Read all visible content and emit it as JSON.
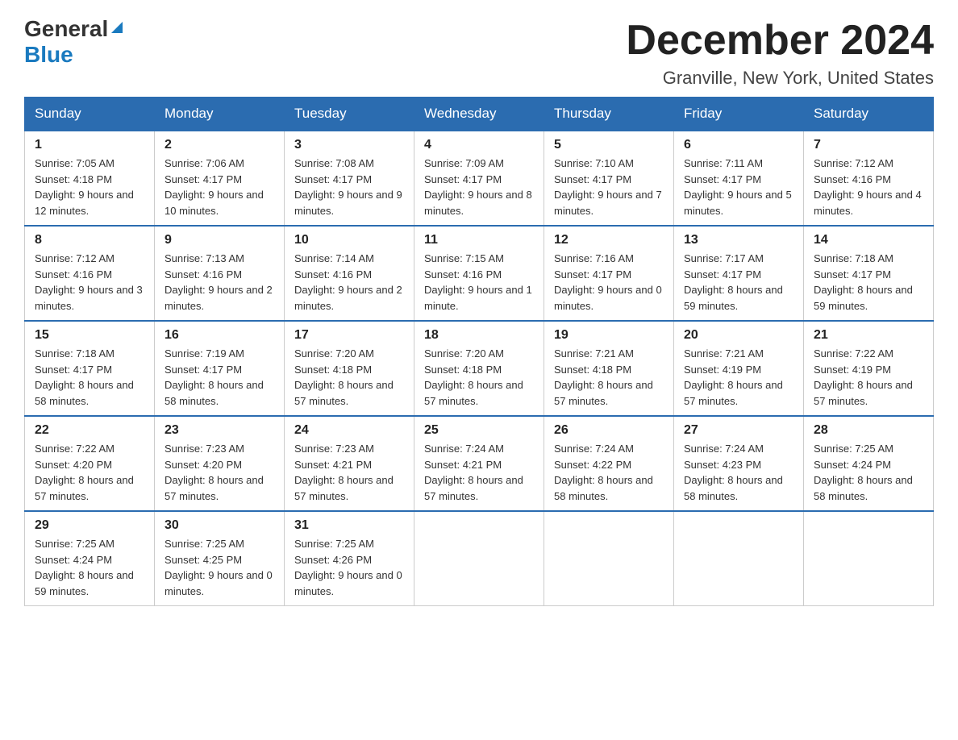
{
  "header": {
    "logo_general": "General",
    "logo_blue": "Blue",
    "month_title": "December 2024",
    "location": "Granville, New York, United States"
  },
  "days_of_week": [
    "Sunday",
    "Monday",
    "Tuesday",
    "Wednesday",
    "Thursday",
    "Friday",
    "Saturday"
  ],
  "weeks": [
    [
      {
        "day": "1",
        "sunrise": "7:05 AM",
        "sunset": "4:18 PM",
        "daylight": "9 hours and 12 minutes."
      },
      {
        "day": "2",
        "sunrise": "7:06 AM",
        "sunset": "4:17 PM",
        "daylight": "9 hours and 10 minutes."
      },
      {
        "day": "3",
        "sunrise": "7:08 AM",
        "sunset": "4:17 PM",
        "daylight": "9 hours and 9 minutes."
      },
      {
        "day": "4",
        "sunrise": "7:09 AM",
        "sunset": "4:17 PM",
        "daylight": "9 hours and 8 minutes."
      },
      {
        "day": "5",
        "sunrise": "7:10 AM",
        "sunset": "4:17 PM",
        "daylight": "9 hours and 7 minutes."
      },
      {
        "day": "6",
        "sunrise": "7:11 AM",
        "sunset": "4:17 PM",
        "daylight": "9 hours and 5 minutes."
      },
      {
        "day": "7",
        "sunrise": "7:12 AM",
        "sunset": "4:16 PM",
        "daylight": "9 hours and 4 minutes."
      }
    ],
    [
      {
        "day": "8",
        "sunrise": "7:12 AM",
        "sunset": "4:16 PM",
        "daylight": "9 hours and 3 minutes."
      },
      {
        "day": "9",
        "sunrise": "7:13 AM",
        "sunset": "4:16 PM",
        "daylight": "9 hours and 2 minutes."
      },
      {
        "day": "10",
        "sunrise": "7:14 AM",
        "sunset": "4:16 PM",
        "daylight": "9 hours and 2 minutes."
      },
      {
        "day": "11",
        "sunrise": "7:15 AM",
        "sunset": "4:16 PM",
        "daylight": "9 hours and 1 minute."
      },
      {
        "day": "12",
        "sunrise": "7:16 AM",
        "sunset": "4:17 PM",
        "daylight": "9 hours and 0 minutes."
      },
      {
        "day": "13",
        "sunrise": "7:17 AM",
        "sunset": "4:17 PM",
        "daylight": "8 hours and 59 minutes."
      },
      {
        "day": "14",
        "sunrise": "7:18 AM",
        "sunset": "4:17 PM",
        "daylight": "8 hours and 59 minutes."
      }
    ],
    [
      {
        "day": "15",
        "sunrise": "7:18 AM",
        "sunset": "4:17 PM",
        "daylight": "8 hours and 58 minutes."
      },
      {
        "day": "16",
        "sunrise": "7:19 AM",
        "sunset": "4:17 PM",
        "daylight": "8 hours and 58 minutes."
      },
      {
        "day": "17",
        "sunrise": "7:20 AM",
        "sunset": "4:18 PM",
        "daylight": "8 hours and 57 minutes."
      },
      {
        "day": "18",
        "sunrise": "7:20 AM",
        "sunset": "4:18 PM",
        "daylight": "8 hours and 57 minutes."
      },
      {
        "day": "19",
        "sunrise": "7:21 AM",
        "sunset": "4:18 PM",
        "daylight": "8 hours and 57 minutes."
      },
      {
        "day": "20",
        "sunrise": "7:21 AM",
        "sunset": "4:19 PM",
        "daylight": "8 hours and 57 minutes."
      },
      {
        "day": "21",
        "sunrise": "7:22 AM",
        "sunset": "4:19 PM",
        "daylight": "8 hours and 57 minutes."
      }
    ],
    [
      {
        "day": "22",
        "sunrise": "7:22 AM",
        "sunset": "4:20 PM",
        "daylight": "8 hours and 57 minutes."
      },
      {
        "day": "23",
        "sunrise": "7:23 AM",
        "sunset": "4:20 PM",
        "daylight": "8 hours and 57 minutes."
      },
      {
        "day": "24",
        "sunrise": "7:23 AM",
        "sunset": "4:21 PM",
        "daylight": "8 hours and 57 minutes."
      },
      {
        "day": "25",
        "sunrise": "7:24 AM",
        "sunset": "4:21 PM",
        "daylight": "8 hours and 57 minutes."
      },
      {
        "day": "26",
        "sunrise": "7:24 AM",
        "sunset": "4:22 PM",
        "daylight": "8 hours and 58 minutes."
      },
      {
        "day": "27",
        "sunrise": "7:24 AM",
        "sunset": "4:23 PM",
        "daylight": "8 hours and 58 minutes."
      },
      {
        "day": "28",
        "sunrise": "7:25 AM",
        "sunset": "4:24 PM",
        "daylight": "8 hours and 58 minutes."
      }
    ],
    [
      {
        "day": "29",
        "sunrise": "7:25 AM",
        "sunset": "4:24 PM",
        "daylight": "8 hours and 59 minutes."
      },
      {
        "day": "30",
        "sunrise": "7:25 AM",
        "sunset": "4:25 PM",
        "daylight": "9 hours and 0 minutes."
      },
      {
        "day": "31",
        "sunrise": "7:25 AM",
        "sunset": "4:26 PM",
        "daylight": "9 hours and 0 minutes."
      },
      null,
      null,
      null,
      null
    ]
  ]
}
